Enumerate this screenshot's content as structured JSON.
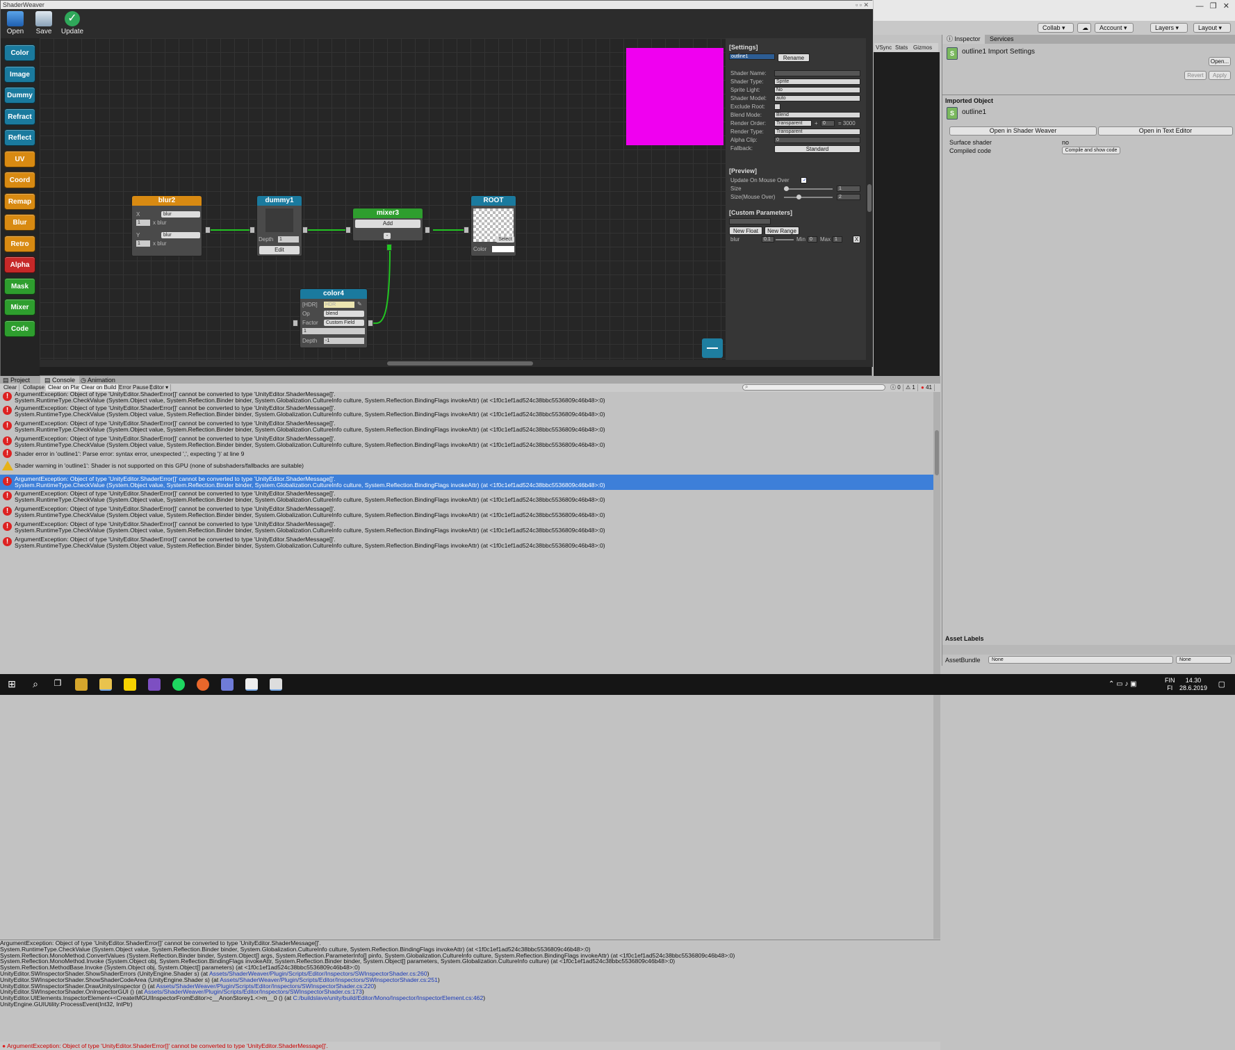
{
  "sw": {
    "title": "ShaderWeaver",
    "toolbar": [
      "Open",
      "Save",
      "Update"
    ]
  },
  "palette": [
    {
      "label": "Color",
      "color": "#1a7a9e"
    },
    {
      "label": "Image",
      "color": "#1a7a9e"
    },
    {
      "label": "Dummy",
      "color": "#1a7a9e"
    },
    {
      "label": "Refract",
      "color": "#1a7a9e"
    },
    {
      "label": "Reflect",
      "color": "#1a7a9e"
    },
    {
      "label": "UV",
      "color": "#d88a12"
    },
    {
      "label": "Coord",
      "color": "#d88a12"
    },
    {
      "label": "Remap",
      "color": "#d88a12"
    },
    {
      "label": "Blur",
      "color": "#d88a12"
    },
    {
      "label": "Retro",
      "color": "#d88a12"
    },
    {
      "label": "Alpha",
      "color": "#c62828"
    },
    {
      "label": "Mask",
      "color": "#2e9e2e"
    },
    {
      "label": "Mixer",
      "color": "#2e9e2e"
    },
    {
      "label": "Code",
      "color": "#2e9e2e"
    }
  ],
  "nodes": {
    "blur2": {
      "title": "blur2",
      "x_label": "X",
      "x_sel": "blur",
      "x_val": "1",
      "x_text": "x  blur",
      "y_label": "Y",
      "y_sel": "blur",
      "y_val": "1",
      "y_text": "x  blur"
    },
    "dummy1": {
      "title": "dummy1",
      "depth_label": "Depth",
      "depth_val": "1",
      "edit": "Edit"
    },
    "mixer3": {
      "title": "mixer3",
      "add": "Add",
      "minus": "-"
    },
    "root": {
      "title": "ROOT",
      "select": "Select",
      "color_label": "Color"
    },
    "color4": {
      "title": "color4",
      "hdr": "[HDR]",
      "hdr_val": "HDR",
      "op_label": "Op",
      "op_val": "blend",
      "factor_label": "Factor",
      "factor_val": "Custom Field",
      "val1": "1",
      "depth_label": "Depth",
      "depth_val": "-1"
    }
  },
  "settings": {
    "header": "[Settings]",
    "name_field": "outline1",
    "rename": "Rename",
    "rows": [
      {
        "label": "Shader Name:",
        "value": ""
      },
      {
        "label": "Shader Type:",
        "value": "Sprite"
      },
      {
        "label": "Sprite Light:",
        "value": "No"
      },
      {
        "label": "Shader Model:",
        "value": "auto"
      },
      {
        "label": "Exclude Root:",
        "value": ""
      },
      {
        "label": "Blend Mode:",
        "value": "Blend"
      },
      {
        "label": "Render Order:",
        "value": "Transparent"
      },
      {
        "label": "Render Type:",
        "value": "Transparent"
      },
      {
        "label": "Alpha Clip:",
        "value": "0"
      },
      {
        "label": "Fallback:",
        "value": "Standard"
      }
    ],
    "render_plus": "+",
    "render_add": "0",
    "render_total": "= 3000",
    "preview_header": "[Preview]",
    "update_mouse": "Update On Mouse Over",
    "size_label": "Size",
    "size_val": "1",
    "size_mouse_label": "Size(Mouse Over)",
    "size_mouse_val": "2",
    "custom_header": "[Custom Parameters]",
    "new_float": "New Float",
    "new_range": "New Range",
    "param": {
      "name": "blur",
      "value": "0.1",
      "min_label": "Min",
      "min": "0",
      "max_label": "Max",
      "max": "1",
      "remove": "X"
    }
  },
  "game": {
    "tabs": [
      "VSync",
      "Stats",
      "Gizmos"
    ]
  },
  "unity": {
    "collab": "Collab",
    "account": "Account",
    "layers": "Layers",
    "layout": "Layout"
  },
  "inspector": {
    "tabs": [
      "Inspector",
      "Services"
    ],
    "title": "outline1 Import Settings",
    "open": "Open...",
    "revert": "Revert",
    "apply": "Apply",
    "section": "Imported Object",
    "object_name": "outline1",
    "btn_shader_weaver": "Open in Shader Weaver",
    "btn_text_editor": "Open in Text Editor",
    "surface_label": "Surface shader",
    "surface_val": "no",
    "compiled_label": "Compiled code",
    "compile_btn": "Compile and show code",
    "asset_labels": "Asset Labels",
    "asset_bundle": "AssetBundle",
    "bundle_val": "None",
    "variant_val": "None"
  },
  "console": {
    "tabs": [
      "Project",
      "Console",
      "Animation"
    ],
    "buttons": [
      "Clear",
      "Collapse",
      "Clear on Play",
      "Clear on Build",
      "Error Pause",
      "Editor"
    ],
    "counts": [
      "0",
      "1",
      "41"
    ],
    "logs": [
      {
        "type": "error",
        "l1": "ArgumentException: Object of type 'UnityEditor.ShaderError[]' cannot be converted to type 'UnityEditor.ShaderMessage[]'.",
        "l2": "System.RuntimeType.CheckValue (System.Object value, System.Reflection.Binder binder, System.Globalization.CultureInfo culture, System.Reflection.BindingFlags invokeAttr) (at <1f0c1ef1ad524c38bbc5536809c46b48>:0)",
        "sel": false
      },
      {
        "type": "error",
        "l1": "ArgumentException: Object of type 'UnityEditor.ShaderError[]' cannot be converted to type 'UnityEditor.ShaderMessage[]'.",
        "l2": "System.RuntimeType.CheckValue (System.Object value, System.Reflection.Binder binder, System.Globalization.CultureInfo culture, System.Reflection.BindingFlags invokeAttr) (at <1f0c1ef1ad524c38bbc5536809c46b48>:0)",
        "sel": false
      },
      {
        "type": "error",
        "l1": "ArgumentException: Object of type 'UnityEditor.ShaderError[]' cannot be converted to type 'UnityEditor.ShaderMessage[]'.",
        "l2": "System.RuntimeType.CheckValue (System.Object value, System.Reflection.Binder binder, System.Globalization.CultureInfo culture, System.Reflection.BindingFlags invokeAttr) (at <1f0c1ef1ad524c38bbc5536809c46b48>:0)",
        "sel": false
      },
      {
        "type": "error",
        "l1": "ArgumentException: Object of type 'UnityEditor.ShaderError[]' cannot be converted to type 'UnityEditor.ShaderMessage[]'.",
        "l2": "System.RuntimeType.CheckValue (System.Object value, System.Reflection.Binder binder, System.Globalization.CultureInfo culture, System.Reflection.BindingFlags invokeAttr) (at <1f0c1ef1ad524c38bbc5536809c46b48>:0)",
        "sel": false
      },
      {
        "type": "error",
        "l1": "Shader error in 'outline1': Parse error: syntax error, unexpected ',', expecting ')' at line 9",
        "l2": "",
        "sel": false
      },
      {
        "type": "warn",
        "l1": "Shader warning in 'outline1': Shader is not supported on this GPU (none of subshaders/fallbacks are suitable)",
        "l2": "",
        "sel": false
      },
      {
        "type": "error",
        "l1": "ArgumentException: Object of type 'UnityEditor.ShaderError[]' cannot be converted to type 'UnityEditor.ShaderMessage[]'.",
        "l2": "System.RuntimeType.CheckValue (System.Object value, System.Reflection.Binder binder, System.Globalization.CultureInfo culture, System.Reflection.BindingFlags invokeAttr) (at <1f0c1ef1ad524c38bbc5536809c46b48>:0)",
        "sel": true
      },
      {
        "type": "error",
        "l1": "ArgumentException: Object of type 'UnityEditor.ShaderError[]' cannot be converted to type 'UnityEditor.ShaderMessage[]'.",
        "l2": "System.RuntimeType.CheckValue (System.Object value, System.Reflection.Binder binder, System.Globalization.CultureInfo culture, System.Reflection.BindingFlags invokeAttr) (at <1f0c1ef1ad524c38bbc5536809c46b48>:0)",
        "sel": false
      },
      {
        "type": "error",
        "l1": "ArgumentException: Object of type 'UnityEditor.ShaderError[]' cannot be converted to type 'UnityEditor.ShaderMessage[]'.",
        "l2": "System.RuntimeType.CheckValue (System.Object value, System.Reflection.Binder binder, System.Globalization.CultureInfo culture, System.Reflection.BindingFlags invokeAttr) (at <1f0c1ef1ad524c38bbc5536809c46b48>:0)",
        "sel": false
      },
      {
        "type": "error",
        "l1": "ArgumentException: Object of type 'UnityEditor.ShaderError[]' cannot be converted to type 'UnityEditor.ShaderMessage[]'.",
        "l2": "System.RuntimeType.CheckValue (System.Object value, System.Reflection.Binder binder, System.Globalization.CultureInfo culture, System.Reflection.BindingFlags invokeAttr) (at <1f0c1ef1ad524c38bbc5536809c46b48>:0)",
        "sel": false
      },
      {
        "type": "error",
        "l1": "ArgumentException: Object of type 'UnityEditor.ShaderError[]' cannot be converted to type 'UnityEditor.ShaderMessage[]'.",
        "l2": "System.RuntimeType.CheckValue (System.Object value, System.Reflection.Binder binder, System.Globalization.CultureInfo culture, System.Reflection.BindingFlags invokeAttr) (at <1f0c1ef1ad524c38bbc5536809c46b48>:0)",
        "sel": false
      }
    ],
    "stack": [
      {
        "t": "ArgumentException: Object of type 'UnityEditor.ShaderError[]' cannot be converted to type 'UnityEditor.ShaderMessage[]'.",
        "link": "",
        "after": ""
      },
      {
        "t": "System.RuntimeType.CheckValue (System.Object value, System.Reflection.Binder binder, System.Globalization.CultureInfo culture, System.Reflection.BindingFlags invokeAttr) (at <1f0c1ef1ad524c38bbc5536809c46b48>:0)",
        "link": "",
        "after": ""
      },
      {
        "t": "System.Reflection.MonoMethod.ConvertValues (System.Reflection.Binder binder, System.Object[] args, System.Reflection.ParameterInfo[] pinfo, System.Globalization.CultureInfo culture, System.Reflection.BindingFlags invokeAttr) (at <1f0c1ef1ad524c38bbc5536809c46b48>:0)",
        "link": "",
        "after": ""
      },
      {
        "t": "System.Reflection.MonoMethod.Invoke (System.Object obj, System.Reflection.BindingFlags invokeAttr, System.Reflection.Binder binder, System.Object[] parameters, System.Globalization.CultureInfo culture) (at <1f0c1ef1ad524c38bbc5536809c46b48>:0)",
        "link": "",
        "after": ""
      },
      {
        "t": "System.Reflection.MethodBase.Invoke (System.Object obj, System.Object[] parameters) (at <1f0c1ef1ad524c38bbc5536809c46b48>:0)",
        "link": "",
        "after": ""
      },
      {
        "t": "UnityEditor.SWInspectorShader.ShowShaderErrors (UnityEngine.Shader s) (at ",
        "link": "Assets/ShaderWeaver/Plugin/Scripts/Editor/Inspectors/SWInspectorShader.cs:260",
        "after": ")"
      },
      {
        "t": "UnityEditor.SWInspectorShader.ShowShaderCodeArea (UnityEngine.Shader s) (at ",
        "link": "Assets/ShaderWeaver/Plugin/Scripts/Editor/Inspectors/SWInspectorShader.cs:251",
        "after": ")"
      },
      {
        "t": "UnityEditor.SWInspectorShader.DrawUnitysInspector () (at ",
        "link": "Assets/ShaderWeaver/Plugin/Scripts/Editor/Inspectors/SWInspectorShader.cs:220",
        "after": ")"
      },
      {
        "t": "UnityEditor.SWInspectorShader.OnInspectorGUI () (at ",
        "link": "Assets/ShaderWeaver/Plugin/Scripts/Editor/Inspectors/SWInspectorShader.cs:173",
        "after": ")"
      },
      {
        "t": "UnityEditor.UIElements.InspectorElement+<CreateIMGUIInspectorFromEditor>c__AnonStorey1.<>m__0 () (at ",
        "link": "C:/buildslave/unity/build/Editor/Mono/Inspector/InspectorElement.cs:462",
        "after": ")"
      },
      {
        "t": "UnityEngine.GUIUtility:ProcessEvent(Int32, IntPtr)",
        "link": "",
        "after": ""
      }
    ],
    "status": "ArgumentException: Object of type 'UnityEditor.ShaderError[]' cannot be converted to type 'UnityEditor.ShaderMessage[]'."
  },
  "taskbar": {
    "lang1": "FIN",
    "lang2": "FI",
    "time": "14.30",
    "date": "28.6.2019"
  },
  "colors": {
    "preview": "#f000f0",
    "selection": "#3d7fd9",
    "link_green": "#22c522"
  }
}
